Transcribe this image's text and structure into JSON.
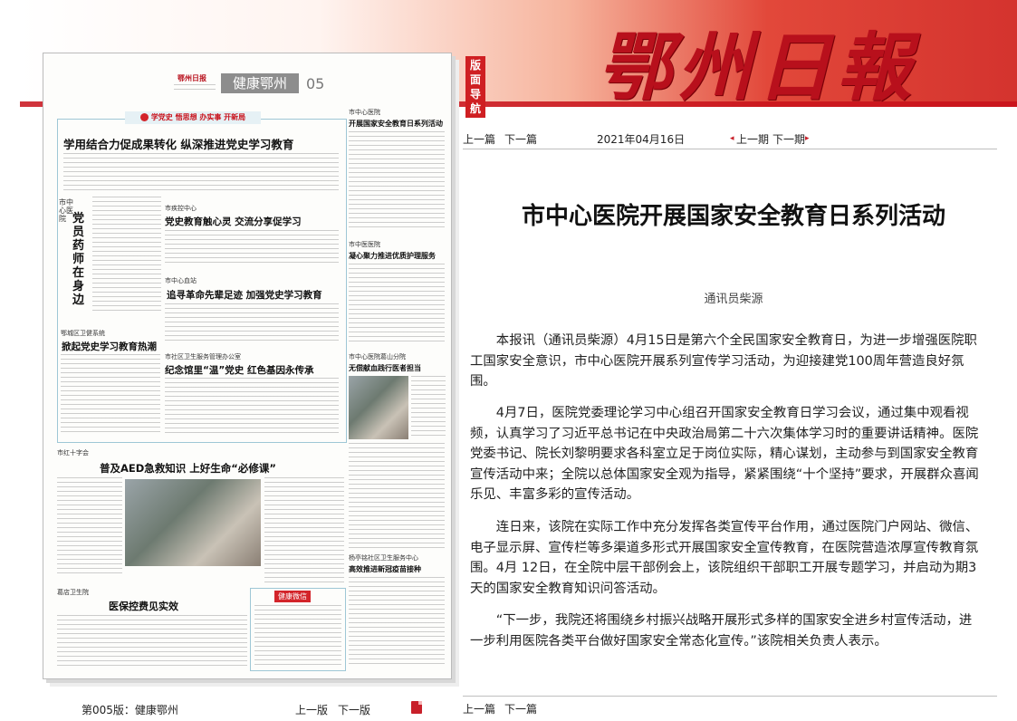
{
  "header": {
    "logo_text": "鄂州日報",
    "nav_tag": "版面导航"
  },
  "thumbnail": {
    "masthead_small": "鄂州日报",
    "section_name": "健康鄂州",
    "page_number": "05",
    "banner_slogan": "学党史 悟思想 办实事 开新局",
    "headline_main": "学用结合力促成果转化  纵深推进党史学习教育",
    "vertical_head": "党员药师在身边",
    "vertical_org": "市中心医院",
    "sub1_org": "市疾控中心",
    "sub1_title": "党史教育触心灵  交流分享促学习",
    "sub2_org": "市中心血站",
    "sub2_title": "追寻革命先辈足迹  加强党史学习教育",
    "sub3_org": "鄂城区卫健系统",
    "sub3_title": "掀起党史学习教育热潮",
    "sub4_org": "市社区卫生服务管理办公室",
    "sub4_title": "纪念馆里“温”党史  红色基因永传承",
    "sub5_org": "市红十字会",
    "sub5_title": "普及AED急救知识  上好生命“必修课”",
    "sub6_org": "葛店卫生院",
    "sub6_title": "医保控费见实效",
    "right1_org": "市中心医院",
    "right1_title": "开展国家安全教育日系列活动",
    "right2_org": "市中医医院",
    "right2_title": "凝心聚力推进优质护理服务",
    "right3_org": "市中心医院葛山分院",
    "right3_title": "无偿献血践行医者担当",
    "right4_org": "杨亭铭社区卫生服务中心",
    "right4_title": "高效推进新冠疫苗接种",
    "wechat_label": "健康微信"
  },
  "nav_top": {
    "prev_article": "上一篇",
    "next_article": "下一篇",
    "date": "2021年04月16日",
    "prev_issue": "上一期",
    "next_issue": "下一期"
  },
  "article": {
    "title": "市中心医院开展国家安全教育日系列活动",
    "byline": "通讯员柴源",
    "paragraphs": [
      "本报讯（通讯员柴源）4月15日是第六个全民国家安全教育日，为进一步增强医院职工国家安全意识，市中心医院开展系列宣传学习活动，为迎接建党100周年营造良好氛围。",
      "4月7日，医院党委理论学习中心组召开国家安全教育日学习会议，通过集中观看视频，认真学习了习近平总书记在中央政治局第二十六次集体学习时的重要讲话精神。医院党委书记、院长刘黎明要求各科室立足于岗位实际，精心谋划，主动参与到国家安全教育宣传活动中来；全院以总体国家安全观为指导，紧紧围绕“十个坚持”要求，开展群众喜闻乐见、丰富多彩的宣传活动。",
      "连日来，该院在实际工作中充分发挥各类宣传平台作用，通过医院门户网站、微信、电子显示屏、宣传栏等多渠道多形式开展国家安全宣传教育，在医院营造浓厚宣传教育氛围。4月 12日，在全院中层干部例会上，该院组织干部职工开展专题学习，并启动为期3天的国家安全教育知识问答活动。",
      "“下一步，我院还将围绕乡村振兴战略开展形式多样的国家安全进乡村宣传活动，进一步利用医院各类平台做好国家安全常态化宣传。”该院相关负责人表示。"
    ]
  },
  "nav_bottom": {
    "prev_article": "上一篇",
    "next_article": "下一篇"
  },
  "footer": {
    "edition_label": "第005版：健康鄂州",
    "prev_page": "上一版",
    "next_page": "下一版",
    "pdf_icon": "pdf-icon"
  },
  "colors": {
    "brand_red": "#c8101a",
    "nav_tag_bg": "#cf1f22"
  }
}
